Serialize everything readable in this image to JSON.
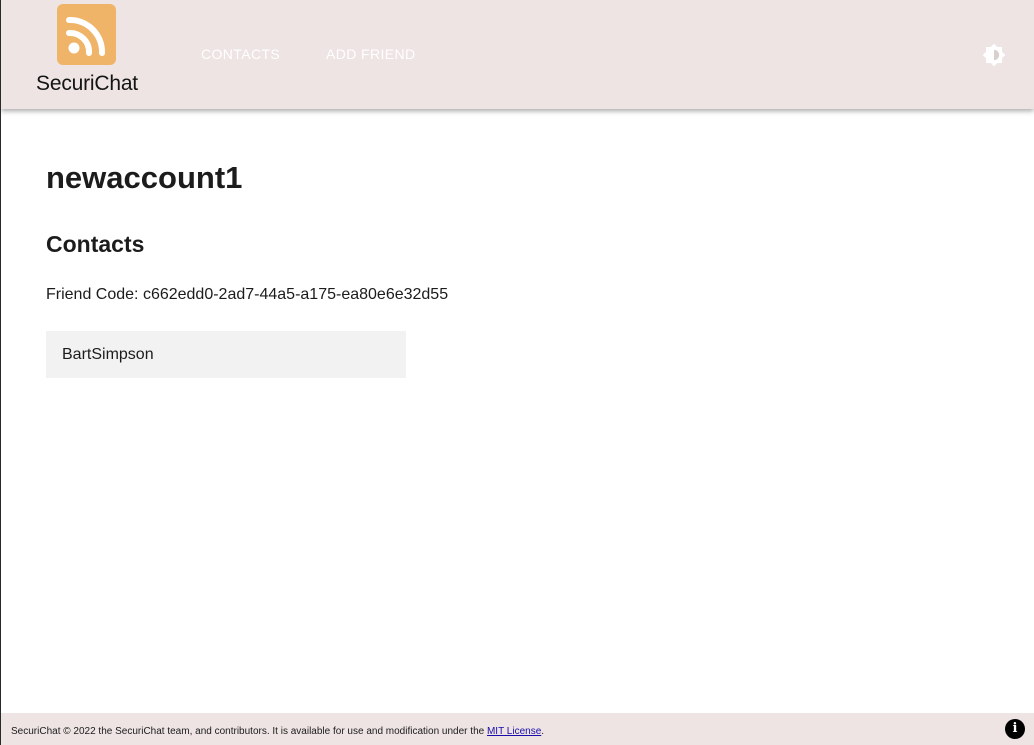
{
  "header": {
    "brand_name": "SecuriChat",
    "logo_icon": "rss-icon",
    "background_color": "#ede4e3",
    "logo_color": "#f0b469",
    "nav": [
      {
        "label": "CONTACTS"
      },
      {
        "label": "ADD FRIEND"
      }
    ],
    "theme_icon": "brightness-icon"
  },
  "main": {
    "username": "newaccount1",
    "section_title": "Contacts",
    "friend_code_label": "Friend Code: ",
    "friend_code": "c662edd0-2ad7-44a5-a175-ea80e6e32d55",
    "contacts": [
      {
        "name": "BartSimpson"
      }
    ]
  },
  "footer": {
    "text_prefix": "SecuriChat © 2022 the SecuriChat team, and contributors. It is available for use and modification under the ",
    "link_text": "MIT License",
    "text_suffix": ".",
    "info_icon_label": "i"
  }
}
